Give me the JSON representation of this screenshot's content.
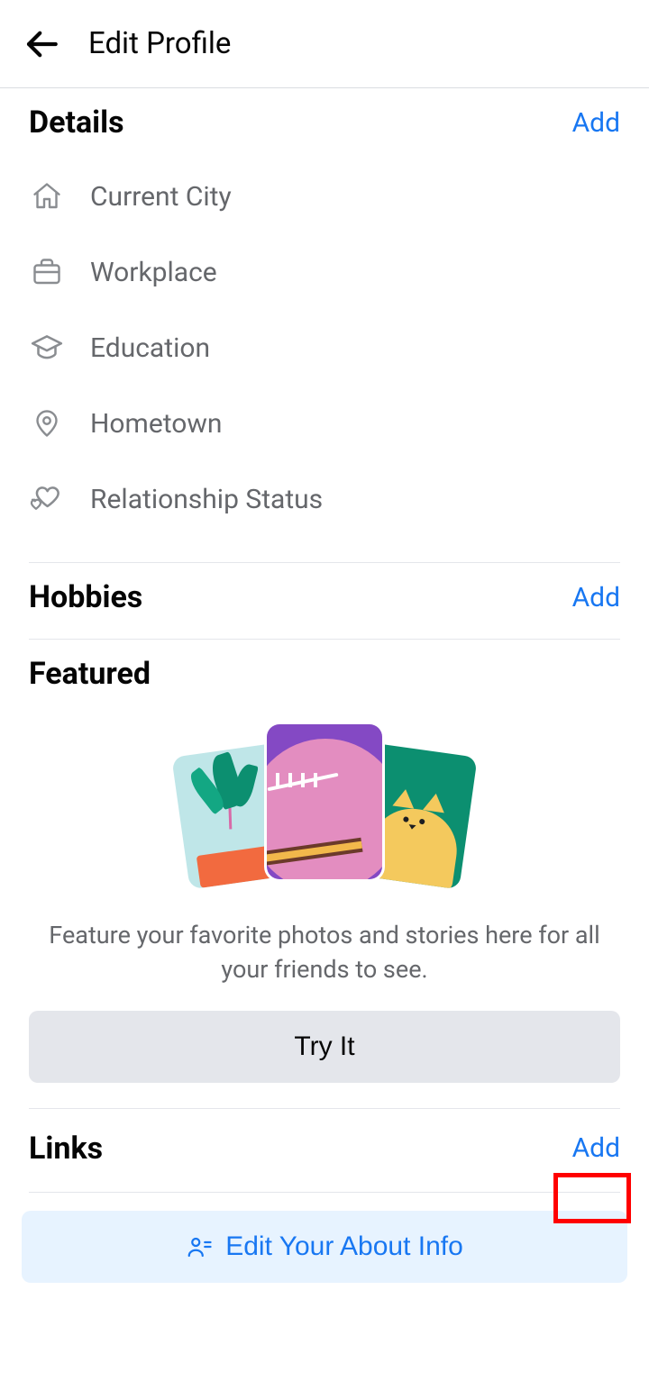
{
  "header": {
    "title": "Edit Profile"
  },
  "details": {
    "title": "Details",
    "add": "Add",
    "items": [
      {
        "label": "Current City",
        "icon": "home-icon"
      },
      {
        "label": "Workplace",
        "icon": "briefcase-icon"
      },
      {
        "label": "Education",
        "icon": "graduation-cap-icon"
      },
      {
        "label": "Hometown",
        "icon": "location-pin-icon"
      },
      {
        "label": "Relationship Status",
        "icon": "hearts-icon"
      }
    ]
  },
  "hobbies": {
    "title": "Hobbies",
    "add": "Add"
  },
  "featured": {
    "title": "Featured",
    "description": "Feature your favorite photos and stories here for all your friends to see.",
    "try_label": "Try It"
  },
  "links": {
    "title": "Links",
    "add": "Add"
  },
  "about_button": "Edit Your About Info",
  "colors": {
    "primary_blue": "#1877f2",
    "highlight": "#ff0000"
  }
}
